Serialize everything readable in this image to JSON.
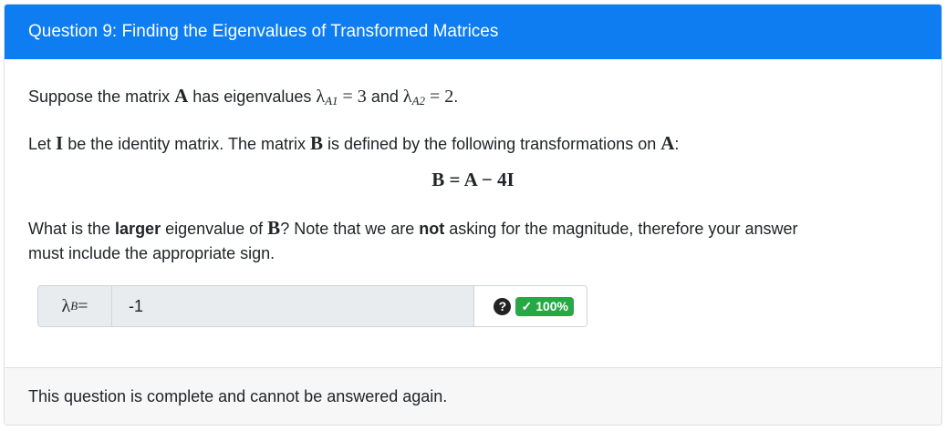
{
  "question": {
    "title": "Question 9: Finding the Eigenvalues of Transformed Matrices",
    "line1": {
      "text_a": "Suppose the matrix ",
      "matrix": "A",
      "text_b": " has eigenvalues ",
      "eig1_sym": "λ",
      "eig1_sub": "A1",
      "eig1_val": " = 3",
      "text_c": " and ",
      "eig2_sym": "λ",
      "eig2_sub": "A2",
      "eig2_val": " = 2",
      "text_d": "."
    },
    "line2": {
      "text_a": "Let ",
      "identity": "I",
      "text_b": " be the identity matrix. The matrix ",
      "matrix": "B",
      "text_c": " is defined by the following transformations on ",
      "matrix2": "A",
      "text_d": ":"
    },
    "equation": "B = A − 4I",
    "line3": {
      "text_a": "What is the ",
      "bold1": "larger",
      "text_b": " eigenvalue of ",
      "matrix": "B",
      "text_c": "? Note that we are ",
      "bold2": "not",
      "text_d": " asking for the magnitude, therefore your answer"
    },
    "line4": "must include the appropriate sign."
  },
  "answer": {
    "label_sym": "λ",
    "label_sub": "B",
    "label_eq": " =",
    "value": "-1",
    "help_icon": "?",
    "score_check": "✓",
    "score": "100%"
  },
  "colors": {
    "header": "#0d7df1",
    "badge": "#28a745"
  },
  "footer": {
    "text": "This question is complete and cannot be answered again."
  }
}
